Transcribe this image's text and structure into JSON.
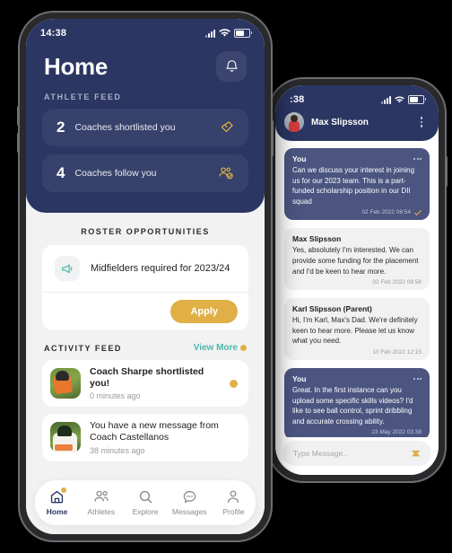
{
  "home": {
    "status": {
      "time": "14:38"
    },
    "header": {
      "title": "Home",
      "bell_icon": "bell-icon"
    },
    "athlete_feed": {
      "label": "ATHLETE FEED",
      "items": [
        {
          "count": "2",
          "text": "Coaches shortlisted you",
          "icon": "bookmark-icon"
        },
        {
          "count": "4",
          "text": "Coaches follow you",
          "icon": "people-check-icon"
        }
      ]
    },
    "roster": {
      "label": "ROSTER OPPORTUNITIES",
      "icon": "megaphone-icon",
      "text": "Midfielders required for 2023/24",
      "apply_label": "Apply"
    },
    "activity": {
      "label": "ACTIVITY FEED",
      "view_more": "View More",
      "items": [
        {
          "title": "Coach Sharpe shortlisted you!",
          "time": "0 minutes ago",
          "unread": true
        },
        {
          "title": "You have a new message from Coach Castellanos",
          "time": "38 minutes ago",
          "unread": false
        }
      ]
    },
    "tabbar": {
      "items": [
        {
          "label": "Home",
          "icon": "home-icon",
          "active": true
        },
        {
          "label": "Athletes",
          "icon": "people-icon",
          "active": false
        },
        {
          "label": "Explore",
          "icon": "search-icon",
          "active": false
        },
        {
          "label": "Messages",
          "icon": "chat-bubble-icon",
          "active": false
        },
        {
          "label": "Profile",
          "icon": "person-icon",
          "active": false
        }
      ]
    }
  },
  "chat": {
    "status": {
      "time": ":38"
    },
    "header": {
      "name": "Max Slipsson",
      "avatar": "avatar",
      "menu_icon": "kebab-menu-icon"
    },
    "messages": [
      {
        "author": "You",
        "side": "out",
        "text": "Can we discuss your interest in joining us for our 2023 team. This is a part-funded scholarship position in our DII squad",
        "time": "02 Feb 2022 08:54"
      },
      {
        "author": "Max Slipsson",
        "side": "in",
        "text": "Yes, absolutely I'm interested.  We can provide some funding for the placement and I'd be keen to hear more.",
        "time": "02 Feb 2022 08:58"
      },
      {
        "author": "Karl Slipsson (Parent)",
        "side": "in",
        "text": "Hi, I'm Karl, Max's Dad.  We're definitely keen to hear more.  Please let us know what you need.",
        "time": "10 Feb 2022 12:15"
      },
      {
        "author": "You",
        "side": "out",
        "text": "Great.  In the first instance can you upload some specific skills videos?  I'd like to see ball control, sprint dribbling and accurate crossing ability.",
        "time": "23 May 2022 03:38"
      }
    ],
    "composer": {
      "placeholder": "Type Message..",
      "send_icon": "send-icon"
    }
  },
  "colors": {
    "navy": "#2b3663",
    "card_navy": "#37426c",
    "gold": "#e0b046",
    "teal": "#4bb8a9",
    "page_bg": "#f2f2f2"
  }
}
